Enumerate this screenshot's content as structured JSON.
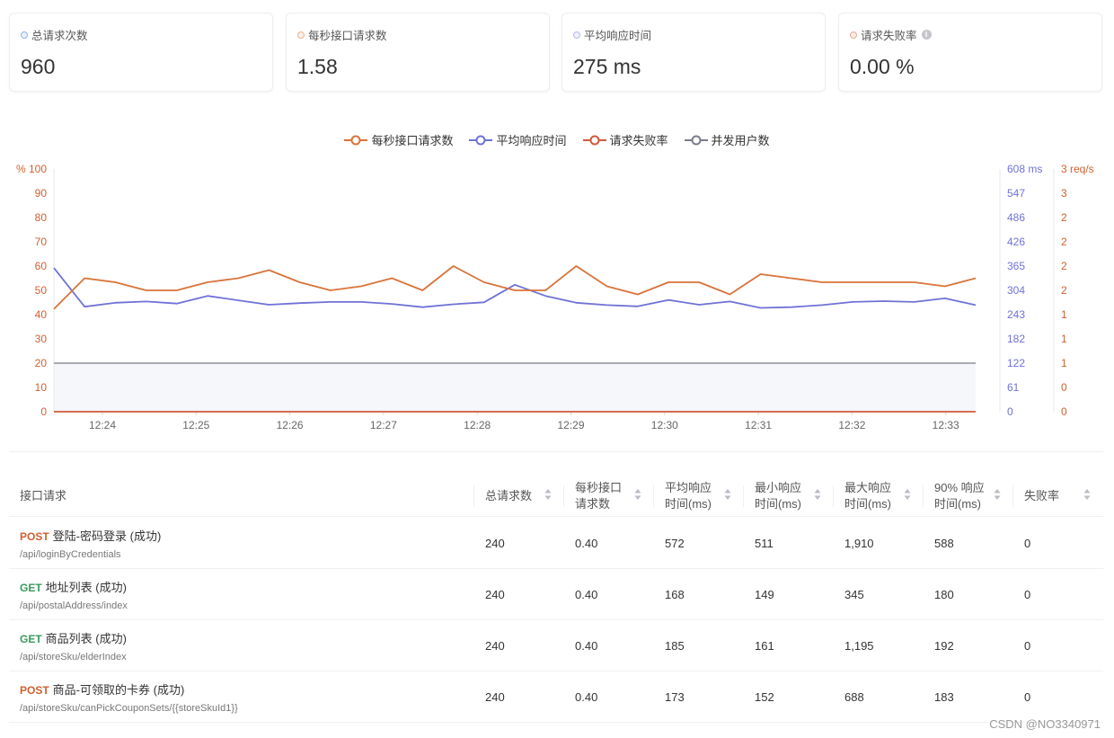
{
  "stats": [
    {
      "label": "总请求次数",
      "value": "960",
      "color": "#8fb4e6"
    },
    {
      "label": "每秒接口请求数",
      "value": "1.58",
      "color": "#e9b48f"
    },
    {
      "label": "平均响应时间",
      "value": "275 ms",
      "color": "#b6b7ee"
    },
    {
      "label": "请求失败率",
      "value": "0.00 %",
      "color": "#e8a898",
      "info": "i"
    }
  ],
  "legend": [
    {
      "name": "每秒接口请求数",
      "color": "#d9733a"
    },
    {
      "name": "平均响应时间",
      "color": "#6f72d6"
    },
    {
      "name": "请求失败率",
      "color": "#cf5a3c"
    },
    {
      "name": "并发用户数",
      "color": "#7a7d88"
    }
  ],
  "chart_data": {
    "type": "line",
    "x_ticks": [
      "12:24",
      "12:25",
      "12:26",
      "12:27",
      "12:28",
      "12:29",
      "12:30",
      "12:31",
      "12:32",
      "12:33"
    ],
    "left_axis": {
      "unit": "%",
      "ticks": [
        "0",
        "10",
        "20",
        "30",
        "40",
        "50",
        "60",
        "70",
        "80",
        "90",
        "100"
      ],
      "ylim": [
        0,
        100
      ]
    },
    "mid_axis": {
      "unit": "ms",
      "ticks": [
        "0",
        "61",
        "122",
        "182",
        "243",
        "304",
        "365",
        "426",
        "486",
        "547",
        "608"
      ],
      "ylim": [
        0,
        608
      ]
    },
    "right_axis": {
      "unit": "req/s",
      "ticks": [
        "0",
        "0",
        "1",
        "1",
        "1",
        "2",
        "2",
        "2",
        "2",
        "3",
        "3"
      ],
      "ylim": [
        0,
        3
      ]
    },
    "series": [
      {
        "name": "每秒接口请求数",
        "axis": "right",
        "color": "#d9733a",
        "values": [
          1.27,
          1.65,
          1.6,
          1.5,
          1.5,
          1.6,
          1.65,
          1.75,
          1.6,
          1.5,
          1.55,
          1.65,
          1.5,
          1.8,
          1.6,
          1.5,
          1.5,
          1.8,
          1.55,
          1.45,
          1.6,
          1.6,
          1.45,
          1.7,
          1.65,
          1.6,
          1.6,
          1.6,
          1.6,
          1.55,
          1.65
        ]
      },
      {
        "name": "平均响应时间",
        "axis": "mid",
        "color": "#6f72d6",
        "values": [
          360,
          263,
          273,
          276,
          271,
          290,
          279,
          268,
          272,
          275,
          275,
          270,
          262,
          269,
          274,
          318,
          290,
          273,
          267,
          264,
          280,
          268,
          276,
          260,
          262,
          267,
          275,
          277,
          275,
          284,
          267
        ]
      },
      {
        "name": "请求失败率",
        "axis": "left",
        "color": "#cf5a3c",
        "values": [
          0,
          0,
          0,
          0,
          0,
          0,
          0,
          0,
          0,
          0,
          0,
          0,
          0,
          0,
          0,
          0,
          0,
          0,
          0,
          0,
          0,
          0,
          0,
          0,
          0,
          0,
          0,
          0,
          0,
          0,
          0
        ]
      },
      {
        "name": "并发用户数",
        "axis": "left",
        "color": "#7a7d88",
        "values": [
          20,
          20,
          20,
          20,
          20,
          20,
          20,
          20,
          20,
          20,
          20,
          20,
          20,
          20,
          20,
          20,
          20,
          20,
          20,
          20,
          20,
          20,
          20,
          20,
          20,
          20,
          20,
          20,
          20,
          20,
          20
        ]
      }
    ]
  },
  "table": {
    "headers": [
      "接口请求",
      "总请求数",
      "每秒接口\n请求数",
      "平均响应\n时间(ms)",
      "最小响应\n时间(ms)",
      "最大响应\n时间(ms)",
      "90% 响应\n时间(ms)",
      "失败率"
    ],
    "rows": [
      {
        "method": "POST",
        "method_color": "#d0602f",
        "name": "登陆-密码登录 (成功)",
        "path": "/api/loginByCredentials",
        "cells": [
          "240",
          "0.40",
          "572",
          "511",
          "1,910",
          "588",
          "0"
        ]
      },
      {
        "method": "GET",
        "method_color": "#3a9a5b",
        "name": "地址列表 (成功)",
        "path": "/api/postalAddress/index",
        "cells": [
          "240",
          "0.40",
          "168",
          "149",
          "345",
          "180",
          "0"
        ]
      },
      {
        "method": "GET",
        "method_color": "#3a9a5b",
        "name": "商品列表 (成功)",
        "path": "/api/storeSku/elderIndex",
        "cells": [
          "240",
          "0.40",
          "185",
          "161",
          "1,195",
          "192",
          "0"
        ]
      },
      {
        "method": "POST",
        "method_color": "#d0602f",
        "name": "商品-可领取的卡券 (成功)",
        "path": "/api/storeSku/canPickCouponSets/{{storeSkuId1}}",
        "cells": [
          "240",
          "0.40",
          "173",
          "152",
          "688",
          "183",
          "0"
        ]
      }
    ]
  },
  "watermark": "CSDN @NO3340971"
}
